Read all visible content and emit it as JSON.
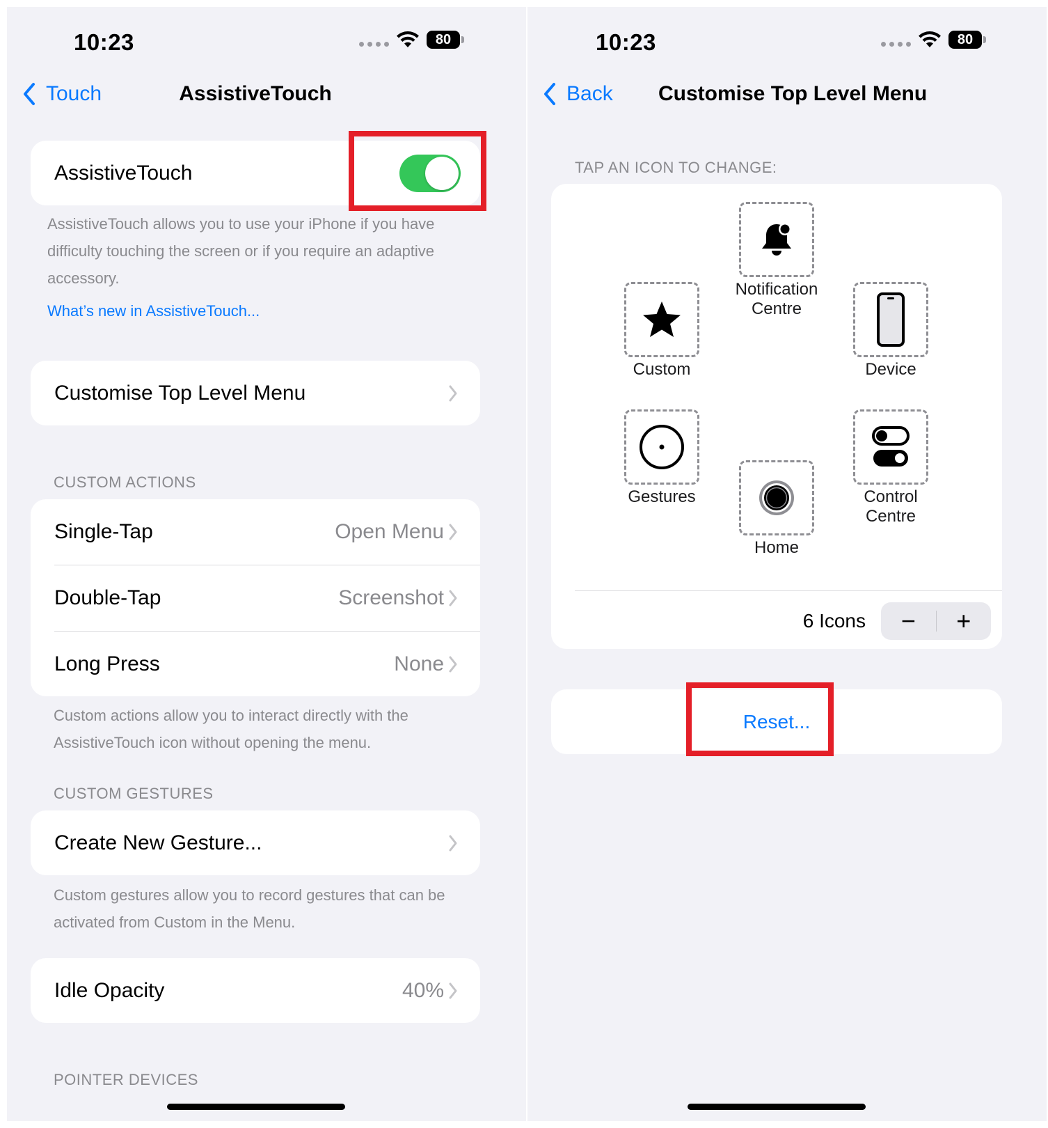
{
  "left": {
    "status": {
      "time": "10:23",
      "battery": "80"
    },
    "nav": {
      "back_label": "Touch",
      "title": "AssistiveTouch"
    },
    "assistive_touch": {
      "label": "AssistiveTouch",
      "toggle_on": true,
      "description": "AssistiveTouch allows you to use your iPhone if you have difficulty touching the screen or if you require an adaptive accessory.",
      "link": "What’s new in AssistiveTouch..."
    },
    "customise_row": {
      "label": "Customise Top Level Menu"
    },
    "custom_actions": {
      "header": "CUSTOM ACTIONS",
      "rows": [
        {
          "label": "Single-Tap",
          "value": "Open Menu"
        },
        {
          "label": "Double-Tap",
          "value": "Screenshot"
        },
        {
          "label": "Long Press",
          "value": "None"
        }
      ],
      "footer": "Custom actions allow you to interact directly with the AssistiveTouch icon without opening the menu."
    },
    "custom_gestures": {
      "header": "CUSTOM GESTURES",
      "row_label": "Create New Gesture...",
      "footer": "Custom gestures allow you to record gestures that can be activated from Custom in the Menu."
    },
    "idle_opacity": {
      "label": "Idle Opacity",
      "value": "40%"
    },
    "pointer_header": "POINTER DEVICES"
  },
  "right": {
    "status": {
      "time": "10:23",
      "battery": "80"
    },
    "nav": {
      "back_label": "Back",
      "title": "Customise Top Level Menu"
    },
    "section_header": "TAP AN ICON TO CHANGE:",
    "icons": {
      "notification": {
        "label_line1": "Notification",
        "label_line2": "Centre",
        "icon": "bell-icon"
      },
      "custom": {
        "label": "Custom",
        "icon": "star-icon"
      },
      "device": {
        "label": "Device",
        "icon": "iphone-icon"
      },
      "gestures": {
        "label": "Gestures",
        "icon": "gesture-circle-icon"
      },
      "control": {
        "label_line1": "Control",
        "label_line2": "Centre",
        "icon": "toggles-icon"
      },
      "home": {
        "label": "Home",
        "icon": "home-button-icon"
      }
    },
    "icon_count": "6 Icons",
    "stepper": {
      "minus": "−",
      "plus": "+"
    },
    "reset_label": "Reset..."
  },
  "colors": {
    "accent": "#0a7aff",
    "toggle_on": "#34c759",
    "highlight": "#e41f28",
    "background": "#f2f2f7"
  }
}
